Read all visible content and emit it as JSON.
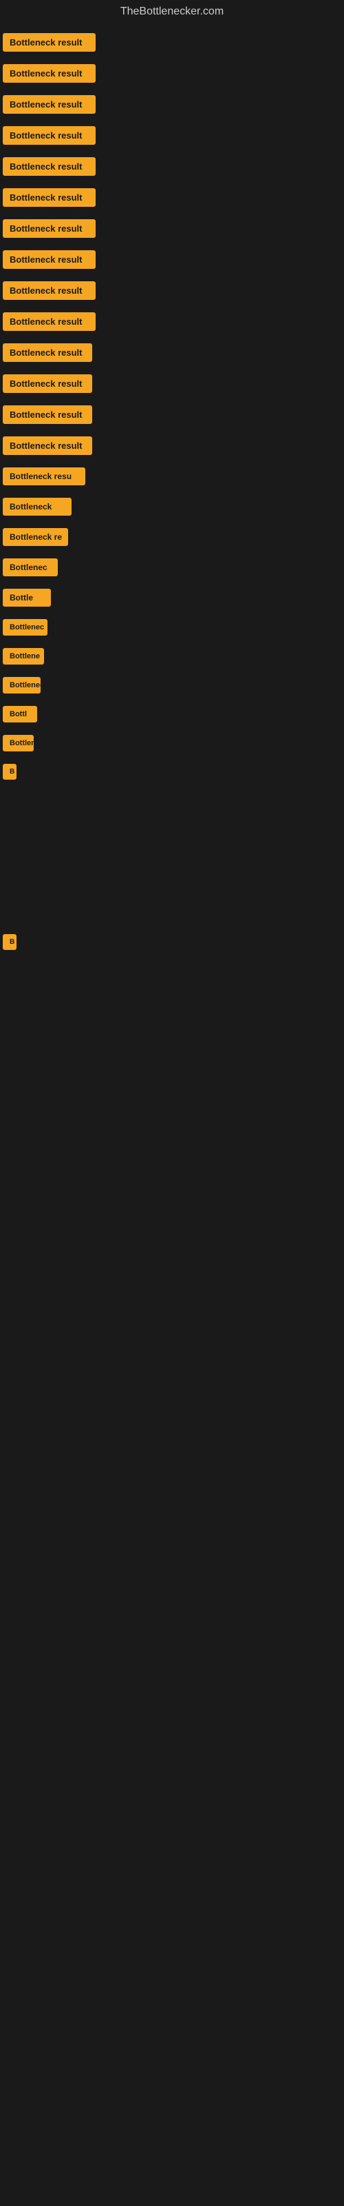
{
  "site": {
    "title": "TheBottlenecker.com"
  },
  "items": [
    {
      "id": 1,
      "label": "Bottleneck result",
      "truncated": "Bottleneck result"
    },
    {
      "id": 2,
      "label": "Bottleneck result",
      "truncated": "Bottleneck result"
    },
    {
      "id": 3,
      "label": "Bottleneck result",
      "truncated": "Bottleneck result"
    },
    {
      "id": 4,
      "label": "Bottleneck result",
      "truncated": "Bottleneck result"
    },
    {
      "id": 5,
      "label": "Bottleneck result",
      "truncated": "Bottleneck result"
    },
    {
      "id": 6,
      "label": "Bottleneck result",
      "truncated": "Bottleneck result"
    },
    {
      "id": 7,
      "label": "Bottleneck result",
      "truncated": "Bottleneck result"
    },
    {
      "id": 8,
      "label": "Bottleneck result",
      "truncated": "Bottleneck result"
    },
    {
      "id": 9,
      "label": "Bottleneck result",
      "truncated": "Bottleneck result"
    },
    {
      "id": 10,
      "label": "Bottleneck result",
      "truncated": "Bottleneck result"
    },
    {
      "id": 11,
      "label": "Bottleneck result",
      "truncated": "Bottleneck result"
    },
    {
      "id": 12,
      "label": "Bottleneck result",
      "truncated": "Bottleneck result"
    },
    {
      "id": 13,
      "label": "Bottleneck result",
      "truncated": "Bottleneck result"
    },
    {
      "id": 14,
      "label": "Bottleneck result",
      "truncated": "Bottleneck result"
    },
    {
      "id": 15,
      "label": "Bottleneck result",
      "truncated": "Bottleneck resu"
    },
    {
      "id": 16,
      "label": "Bottleneck result",
      "truncated": "Bottleneck"
    },
    {
      "id": 17,
      "label": "Bottleneck result",
      "truncated": "Bottleneck re"
    },
    {
      "id": 18,
      "label": "Bottleneck result",
      "truncated": "Bottlenec"
    },
    {
      "id": 19,
      "label": "Bottleneck result",
      "truncated": "Bottle"
    },
    {
      "id": 20,
      "label": "Bottleneck result",
      "truncated": "Bottlenec"
    },
    {
      "id": 21,
      "label": "Bottleneck result",
      "truncated": "Bottlene"
    },
    {
      "id": 22,
      "label": "Bottleneck result",
      "truncated": "Bottleneck"
    },
    {
      "id": 23,
      "label": "Bottleneck result",
      "truncated": "Bottl"
    },
    {
      "id": 24,
      "label": "Bottleneck result",
      "truncated": "Bottlene"
    },
    {
      "id": 25,
      "label": "Bottleneck result",
      "truncated": "B"
    }
  ],
  "colors": {
    "badge_bg": "#f5a623",
    "badge_text": "#1a1a1a",
    "page_bg": "#1a1a1a",
    "site_title": "#cccccc"
  }
}
